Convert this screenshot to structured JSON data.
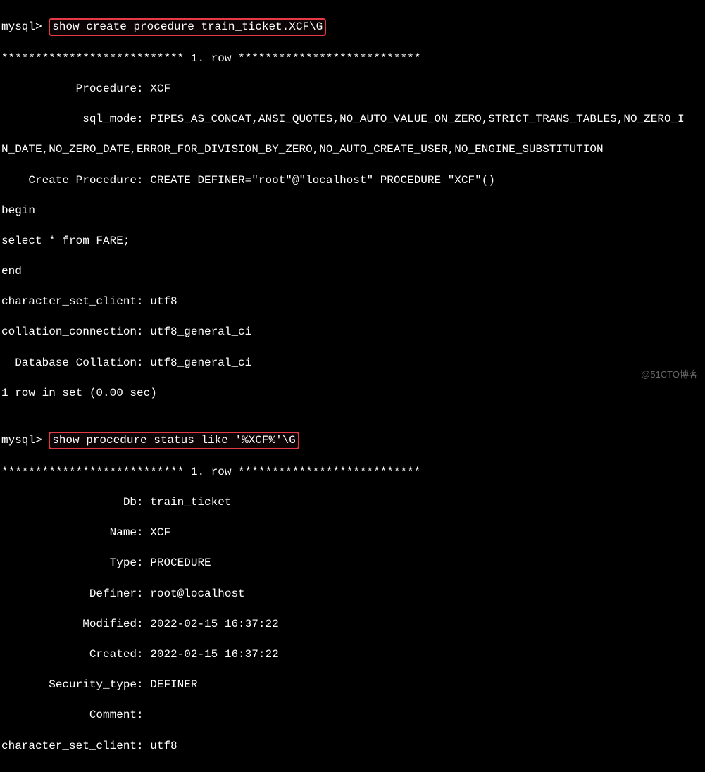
{
  "prompt1": "mysql> ",
  "cmd1": "show create procedure train_ticket.XCF\\G",
  "row_sep1": "*************************** 1. row ***************************",
  "block1": {
    "procedure": "           Procedure: XCF",
    "sql_mode_l1": "            sql_mode: PIPES_AS_CONCAT,ANSI_QUOTES,NO_AUTO_VALUE_ON_ZERO,STRICT_TRANS_TABLES,NO_ZERO_I",
    "sql_mode_l2": "N_DATE,NO_ZERO_DATE,ERROR_FOR_DIVISION_BY_ZERO,NO_AUTO_CREATE_USER,NO_ENGINE_SUBSTITUTION",
    "create_proc": "    Create Procedure: CREATE DEFINER=\"root\"@\"localhost\" PROCEDURE \"XCF\"()",
    "begin": "begin",
    "select": "select * from FARE;",
    "end": "end",
    "charset_client": "character_set_client: utf8",
    "collation_conn": "collation_connection: utf8_general_ci",
    "db_collation": "  Database Collation: utf8_general_ci",
    "rows_msg": "1 row in set (0.00 sec)"
  },
  "blank": "",
  "prompt2": "mysql> ",
  "cmd2": "show procedure status like '%XCF%'\\G",
  "row_sep2": "*************************** 1. row ***************************",
  "block2": {
    "db": "                  Db: train_ticket",
    "name": "                Name: XCF",
    "type": "                Type: PROCEDURE",
    "definer": "             Definer: root@localhost",
    "modified": "            Modified: 2022-02-15 16:37:22",
    "created": "             Created: 2022-02-15 16:37:22",
    "security": "       Security_type: DEFINER",
    "comment": "             Comment:",
    "charset_client": "character_set_client: utf8"
  },
  "watermark": "@51CTO博客"
}
